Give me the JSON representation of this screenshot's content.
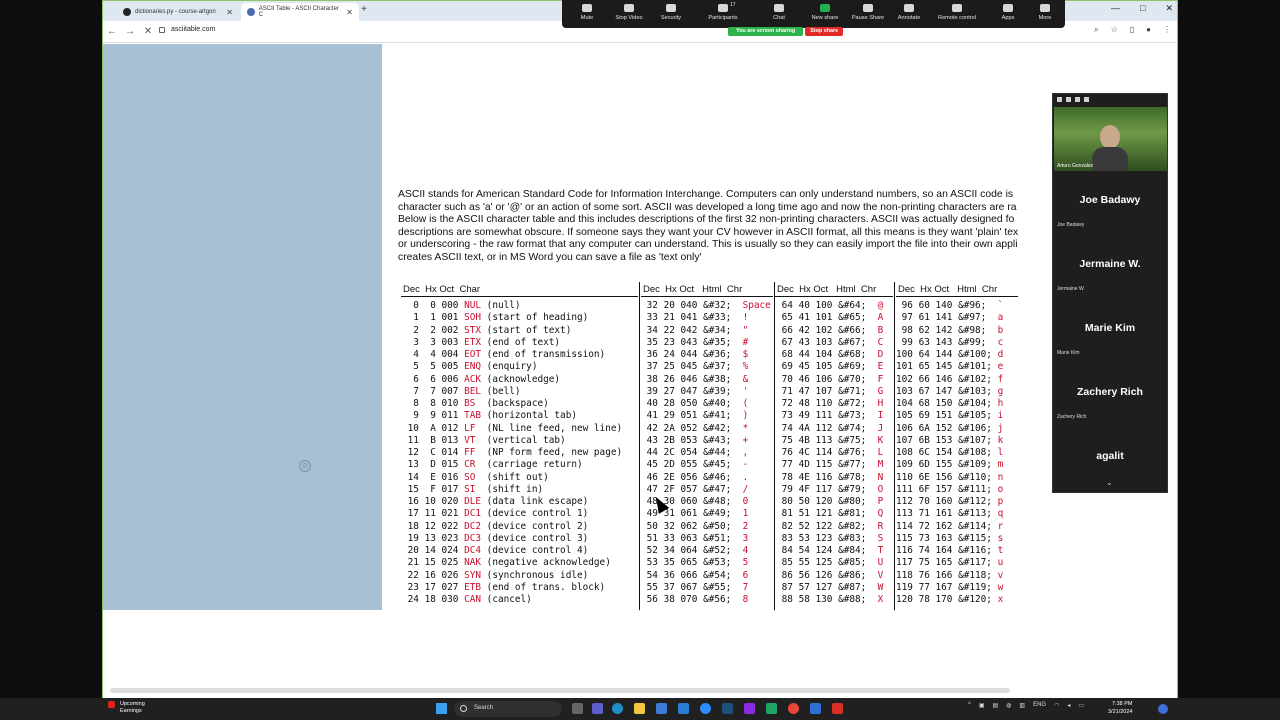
{
  "browser": {
    "tabs": [
      {
        "title": "dictionaries.py - course-artgon",
        "active": false
      },
      {
        "title": "ASCII Table - ASCII Character C",
        "active": true
      }
    ],
    "new_tab": "+",
    "url": "asciitable.com"
  },
  "zoom": {
    "buttons": [
      "Mute",
      "Stop Video",
      "Security",
      "Participants",
      "Chat",
      "New share",
      "Pause Share",
      "Annotate",
      "Remote control",
      "Apps",
      "More"
    ],
    "participant_count": "17",
    "sharing_label": "You are screen sharing",
    "stop_share": "Stop share"
  },
  "participants": {
    "video_name": "Arturo Gonzalez",
    "tiles": [
      {
        "name": "Joe Badawy",
        "label": "Joe Badawy"
      },
      {
        "name": "Jermaine W.",
        "label": "Jermaine W."
      },
      {
        "name": "Marie Kim",
        "label": "Marie Kim"
      },
      {
        "name": "Zachery Rich",
        "label": "Zachery Rich"
      },
      {
        "name": "agalit",
        "label": ""
      }
    ]
  },
  "page": {
    "intro_lines": [
      "ASCII stands for American Standard Code for Information Interchange. Computers can only understand numbers, so an ASCII code is",
      "character such as 'a' or '@' or an action of some sort. ASCII was developed a long time ago and now the non-printing characters are ra",
      "Below is the ASCII character table and this includes descriptions of the first 32 non-printing characters. ASCII was actually designed fo",
      "descriptions are somewhat obscure. If someone says they want your CV however in ASCII format, all this means is they want 'plain' tex",
      "or underscoring - the raw format that any computer can understand. This is usually so they can easily import the file into their own appli",
      "creates ASCII text, or in MS Word you can save a file as 'text only'"
    ]
  },
  "ascii_table": {
    "headers": {
      "block1": "Dec  Hx Oct  Char",
      "block2": "Dec  Hx Oct   Html  Chr",
      "block3": "Dec  Hx Oct   Html  Chr",
      "block4": "Dec  Hx Oct   Html  Chr"
    },
    "control": [
      [
        "0",
        "0",
        "000",
        "NUL",
        "(null)"
      ],
      [
        "1",
        "1",
        "001",
        "SOH",
        "(start of heading)"
      ],
      [
        "2",
        "2",
        "002",
        "STX",
        "(start of text)"
      ],
      [
        "3",
        "3",
        "003",
        "ETX",
        "(end of text)"
      ],
      [
        "4",
        "4",
        "004",
        "EOT",
        "(end of transmission)"
      ],
      [
        "5",
        "5",
        "005",
        "ENQ",
        "(enquiry)"
      ],
      [
        "6",
        "6",
        "006",
        "ACK",
        "(acknowledge)"
      ],
      [
        "7",
        "7",
        "007",
        "BEL",
        "(bell)"
      ],
      [
        "8",
        "8",
        "010",
        "BS",
        "(backspace)"
      ],
      [
        "9",
        "9",
        "011",
        "TAB",
        "(horizontal tab)"
      ],
      [
        "10",
        "A",
        "012",
        "LF",
        "(NL line feed, new line)"
      ],
      [
        "11",
        "B",
        "013",
        "VT",
        "(vertical tab)"
      ],
      [
        "12",
        "C",
        "014",
        "FF",
        "(NP form feed, new page)"
      ],
      [
        "13",
        "D",
        "015",
        "CR",
        "(carriage return)"
      ],
      [
        "14",
        "E",
        "016",
        "SO",
        "(shift out)"
      ],
      [
        "15",
        "F",
        "017",
        "SI",
        "(shift in)"
      ],
      [
        "16",
        "10",
        "020",
        "DLE",
        "(data link escape)"
      ],
      [
        "17",
        "11",
        "021",
        "DC1",
        "(device control 1)"
      ],
      [
        "18",
        "12",
        "022",
        "DC2",
        "(device control 2)"
      ],
      [
        "19",
        "13",
        "023",
        "DC3",
        "(device control 3)"
      ],
      [
        "20",
        "14",
        "024",
        "DC4",
        "(device control 4)"
      ],
      [
        "21",
        "15",
        "025",
        "NAK",
        "(negative acknowledge)"
      ],
      [
        "22",
        "16",
        "026",
        "SYN",
        "(synchronous idle)"
      ],
      [
        "23",
        "17",
        "027",
        "ETB",
        "(end of trans. block)"
      ],
      [
        "24",
        "18",
        "030",
        "CAN",
        "(cancel)"
      ]
    ],
    "block2": [
      [
        "32",
        "20",
        "040",
        "&#32;",
        "Space"
      ],
      [
        "33",
        "21",
        "041",
        "&#33;",
        "!"
      ],
      [
        "34",
        "22",
        "042",
        "&#34;",
        "\""
      ],
      [
        "35",
        "23",
        "043",
        "&#35;",
        "#"
      ],
      [
        "36",
        "24",
        "044",
        "&#36;",
        "$"
      ],
      [
        "37",
        "25",
        "045",
        "&#37;",
        "%"
      ],
      [
        "38",
        "26",
        "046",
        "&#38;",
        "&"
      ],
      [
        "39",
        "27",
        "047",
        "&#39;",
        "'"
      ],
      [
        "40",
        "28",
        "050",
        "&#40;",
        "("
      ],
      [
        "41",
        "29",
        "051",
        "&#41;",
        ")"
      ],
      [
        "42",
        "2A",
        "052",
        "&#42;",
        "*"
      ],
      [
        "43",
        "2B",
        "053",
        "&#43;",
        "+"
      ],
      [
        "44",
        "2C",
        "054",
        "&#44;",
        ","
      ],
      [
        "45",
        "2D",
        "055",
        "&#45;",
        "-"
      ],
      [
        "46",
        "2E",
        "056",
        "&#46;",
        "."
      ],
      [
        "47",
        "2F",
        "057",
        "&#47;",
        "/"
      ],
      [
        "48",
        "30",
        "060",
        "&#48;",
        "0"
      ],
      [
        "49",
        "31",
        "061",
        "&#49;",
        "1"
      ],
      [
        "50",
        "32",
        "062",
        "&#50;",
        "2"
      ],
      [
        "51",
        "33",
        "063",
        "&#51;",
        "3"
      ],
      [
        "52",
        "34",
        "064",
        "&#52;",
        "4"
      ],
      [
        "53",
        "35",
        "065",
        "&#53;",
        "5"
      ],
      [
        "54",
        "36",
        "066",
        "&#54;",
        "6"
      ],
      [
        "55",
        "37",
        "067",
        "&#55;",
        "7"
      ],
      [
        "56",
        "38",
        "070",
        "&#56;",
        "8"
      ]
    ],
    "block3": [
      [
        "64",
        "40",
        "100",
        "&#64;",
        "@"
      ],
      [
        "65",
        "41",
        "101",
        "&#65;",
        "A"
      ],
      [
        "66",
        "42",
        "102",
        "&#66;",
        "B"
      ],
      [
        "67",
        "43",
        "103",
        "&#67;",
        "C"
      ],
      [
        "68",
        "44",
        "104",
        "&#68;",
        "D"
      ],
      [
        "69",
        "45",
        "105",
        "&#69;",
        "E"
      ],
      [
        "70",
        "46",
        "106",
        "&#70;",
        "F"
      ],
      [
        "71",
        "47",
        "107",
        "&#71;",
        "G"
      ],
      [
        "72",
        "48",
        "110",
        "&#72;",
        "H"
      ],
      [
        "73",
        "49",
        "111",
        "&#73;",
        "I"
      ],
      [
        "74",
        "4A",
        "112",
        "&#74;",
        "J"
      ],
      [
        "75",
        "4B",
        "113",
        "&#75;",
        "K"
      ],
      [
        "76",
        "4C",
        "114",
        "&#76;",
        "L"
      ],
      [
        "77",
        "4D",
        "115",
        "&#77;",
        "M"
      ],
      [
        "78",
        "4E",
        "116",
        "&#78;",
        "N"
      ],
      [
        "79",
        "4F",
        "117",
        "&#79;",
        "O"
      ],
      [
        "80",
        "50",
        "120",
        "&#80;",
        "P"
      ],
      [
        "81",
        "51",
        "121",
        "&#81;",
        "Q"
      ],
      [
        "82",
        "52",
        "122",
        "&#82;",
        "R"
      ],
      [
        "83",
        "53",
        "123",
        "&#83;",
        "S"
      ],
      [
        "84",
        "54",
        "124",
        "&#84;",
        "T"
      ],
      [
        "85",
        "55",
        "125",
        "&#85;",
        "U"
      ],
      [
        "86",
        "56",
        "126",
        "&#86;",
        "V"
      ],
      [
        "87",
        "57",
        "127",
        "&#87;",
        "W"
      ],
      [
        "88",
        "58",
        "130",
        "&#88;",
        "X"
      ]
    ],
    "block4": [
      [
        "96",
        "60",
        "140",
        "&#96;",
        "`"
      ],
      [
        "97",
        "61",
        "141",
        "&#97;",
        "a"
      ],
      [
        "98",
        "62",
        "142",
        "&#98;",
        "b"
      ],
      [
        "99",
        "63",
        "143",
        "&#99;",
        "c"
      ],
      [
        "100",
        "64",
        "144",
        "&#100;",
        "d"
      ],
      [
        "101",
        "65",
        "145",
        "&#101;",
        "e"
      ],
      [
        "102",
        "66",
        "146",
        "&#102;",
        "f"
      ],
      [
        "103",
        "67",
        "147",
        "&#103;",
        "g"
      ],
      [
        "104",
        "68",
        "150",
        "&#104;",
        "h"
      ],
      [
        "105",
        "69",
        "151",
        "&#105;",
        "i"
      ],
      [
        "106",
        "6A",
        "152",
        "&#106;",
        "j"
      ],
      [
        "107",
        "6B",
        "153",
        "&#107;",
        "k"
      ],
      [
        "108",
        "6C",
        "154",
        "&#108;",
        "l"
      ],
      [
        "109",
        "6D",
        "155",
        "&#109;",
        "m"
      ],
      [
        "110",
        "6E",
        "156",
        "&#110;",
        "n"
      ],
      [
        "111",
        "6F",
        "157",
        "&#111;",
        "o"
      ],
      [
        "112",
        "70",
        "160",
        "&#112;",
        "p"
      ],
      [
        "113",
        "71",
        "161",
        "&#113;",
        "q"
      ],
      [
        "114",
        "72",
        "162",
        "&#114;",
        "r"
      ],
      [
        "115",
        "73",
        "163",
        "&#115;",
        "s"
      ],
      [
        "116",
        "74",
        "164",
        "&#116;",
        "t"
      ],
      [
        "117",
        "75",
        "165",
        "&#117;",
        "u"
      ],
      [
        "118",
        "76",
        "166",
        "&#118;",
        "v"
      ],
      [
        "119",
        "77",
        "167",
        "&#119;",
        "w"
      ],
      [
        "120",
        "78",
        "170",
        "&#120;",
        "x"
      ]
    ]
  },
  "taskbar": {
    "weather_line1": "Upcoming",
    "weather_line2": "Earnings",
    "search_placeholder": "Search",
    "lang": "ENG",
    "time": "7:38 PM",
    "date": "3/21/2024"
  },
  "colors": {
    "sidebar": "#a7c0d3",
    "control_code": "#c8102e",
    "zoom_bg": "#1b1b1b",
    "share_green": "#2db34a",
    "stop_red": "#e02a2a"
  }
}
